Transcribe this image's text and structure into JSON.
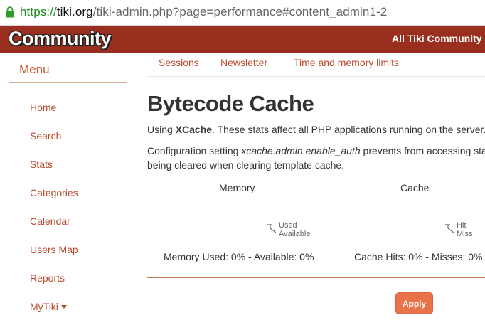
{
  "browser": {
    "url_scheme": "https://",
    "url_host": "tiki.org",
    "url_path": "/tiki-admin.php?page=performance#content_admin1-2"
  },
  "banner": {
    "logo_text": "Community",
    "site_link": "All Tiki Community Si"
  },
  "sidebar": {
    "title": "Menu",
    "items": [
      {
        "label": "Home"
      },
      {
        "label": "Search"
      },
      {
        "label": "Stats"
      },
      {
        "label": "Categories"
      },
      {
        "label": "Calendar"
      },
      {
        "label": "Users Map"
      },
      {
        "label": "Reports"
      },
      {
        "label": "MyTiki"
      }
    ]
  },
  "tabs": [
    {
      "label": "Sessions"
    },
    {
      "label": "Newsletter"
    },
    {
      "label": "Time and memory limits"
    }
  ],
  "main": {
    "title": "Bytecode Cache",
    "intro_prefix": "Using ",
    "intro_engine": "XCache",
    "intro_suffix": ". These stats affect all PHP applications running on the server.",
    "config_prefix": "Configuration setting ",
    "config_setting": "xcache.admin.enable_auth",
    "config_suffix": " prevents from accessing stati",
    "config_line2": "being cleared when clearing template cache.",
    "memory": {
      "heading": "Memory",
      "legend": [
        "Used",
        "Available"
      ],
      "summary": "Memory Used: 0% - Available: 0%",
      "used_percent": 0,
      "available_percent": 0
    },
    "cache": {
      "heading": "Cache",
      "legend": [
        "Hit",
        "Miss"
      ],
      "summary": "Cache Hits: 0% - Misses: 0%",
      "hits_percent": 0,
      "misses_percent": 0
    },
    "apply_label": "Apply"
  },
  "colors": {
    "banner": "#9b2f1f",
    "link": "#b94a2c",
    "button": "#e8734a",
    "secure_green": "#1e8e1e"
  }
}
